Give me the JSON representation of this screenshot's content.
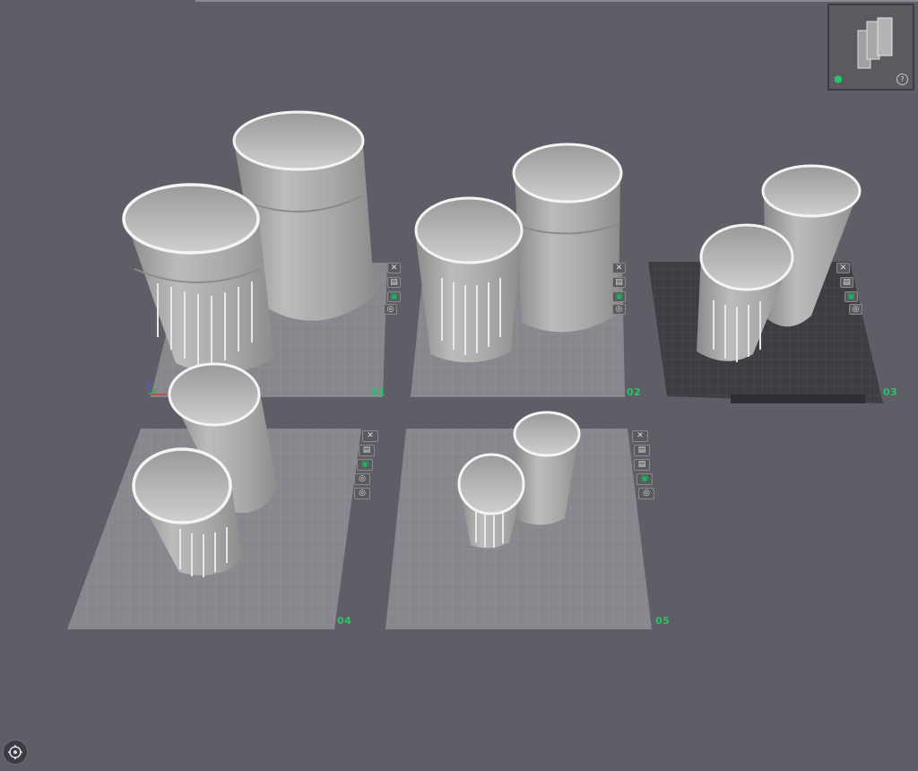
{
  "plates": [
    {
      "id": "01",
      "label": "01"
    },
    {
      "id": "02",
      "label": "02"
    },
    {
      "id": "03",
      "label": "03"
    },
    {
      "id": "04",
      "label": "04"
    },
    {
      "id": "05",
      "label": "05"
    }
  ],
  "controls": {
    "close": "✕",
    "layers": "▤",
    "lock": "▣",
    "settings": "◎"
  },
  "colors": {
    "background": "#5e5e66",
    "plate": "#8e8e94",
    "plate_dark": "#3d3d42",
    "accent": "#27c463",
    "model": "#b4b4b4",
    "model_rim": "#f4f4f4"
  },
  "navcube": {
    "help": "?"
  },
  "icons": [
    "close-icon",
    "layers-icon",
    "lock-icon",
    "settings-icon",
    "navcube-icon",
    "help-icon",
    "view-home-icon"
  ]
}
